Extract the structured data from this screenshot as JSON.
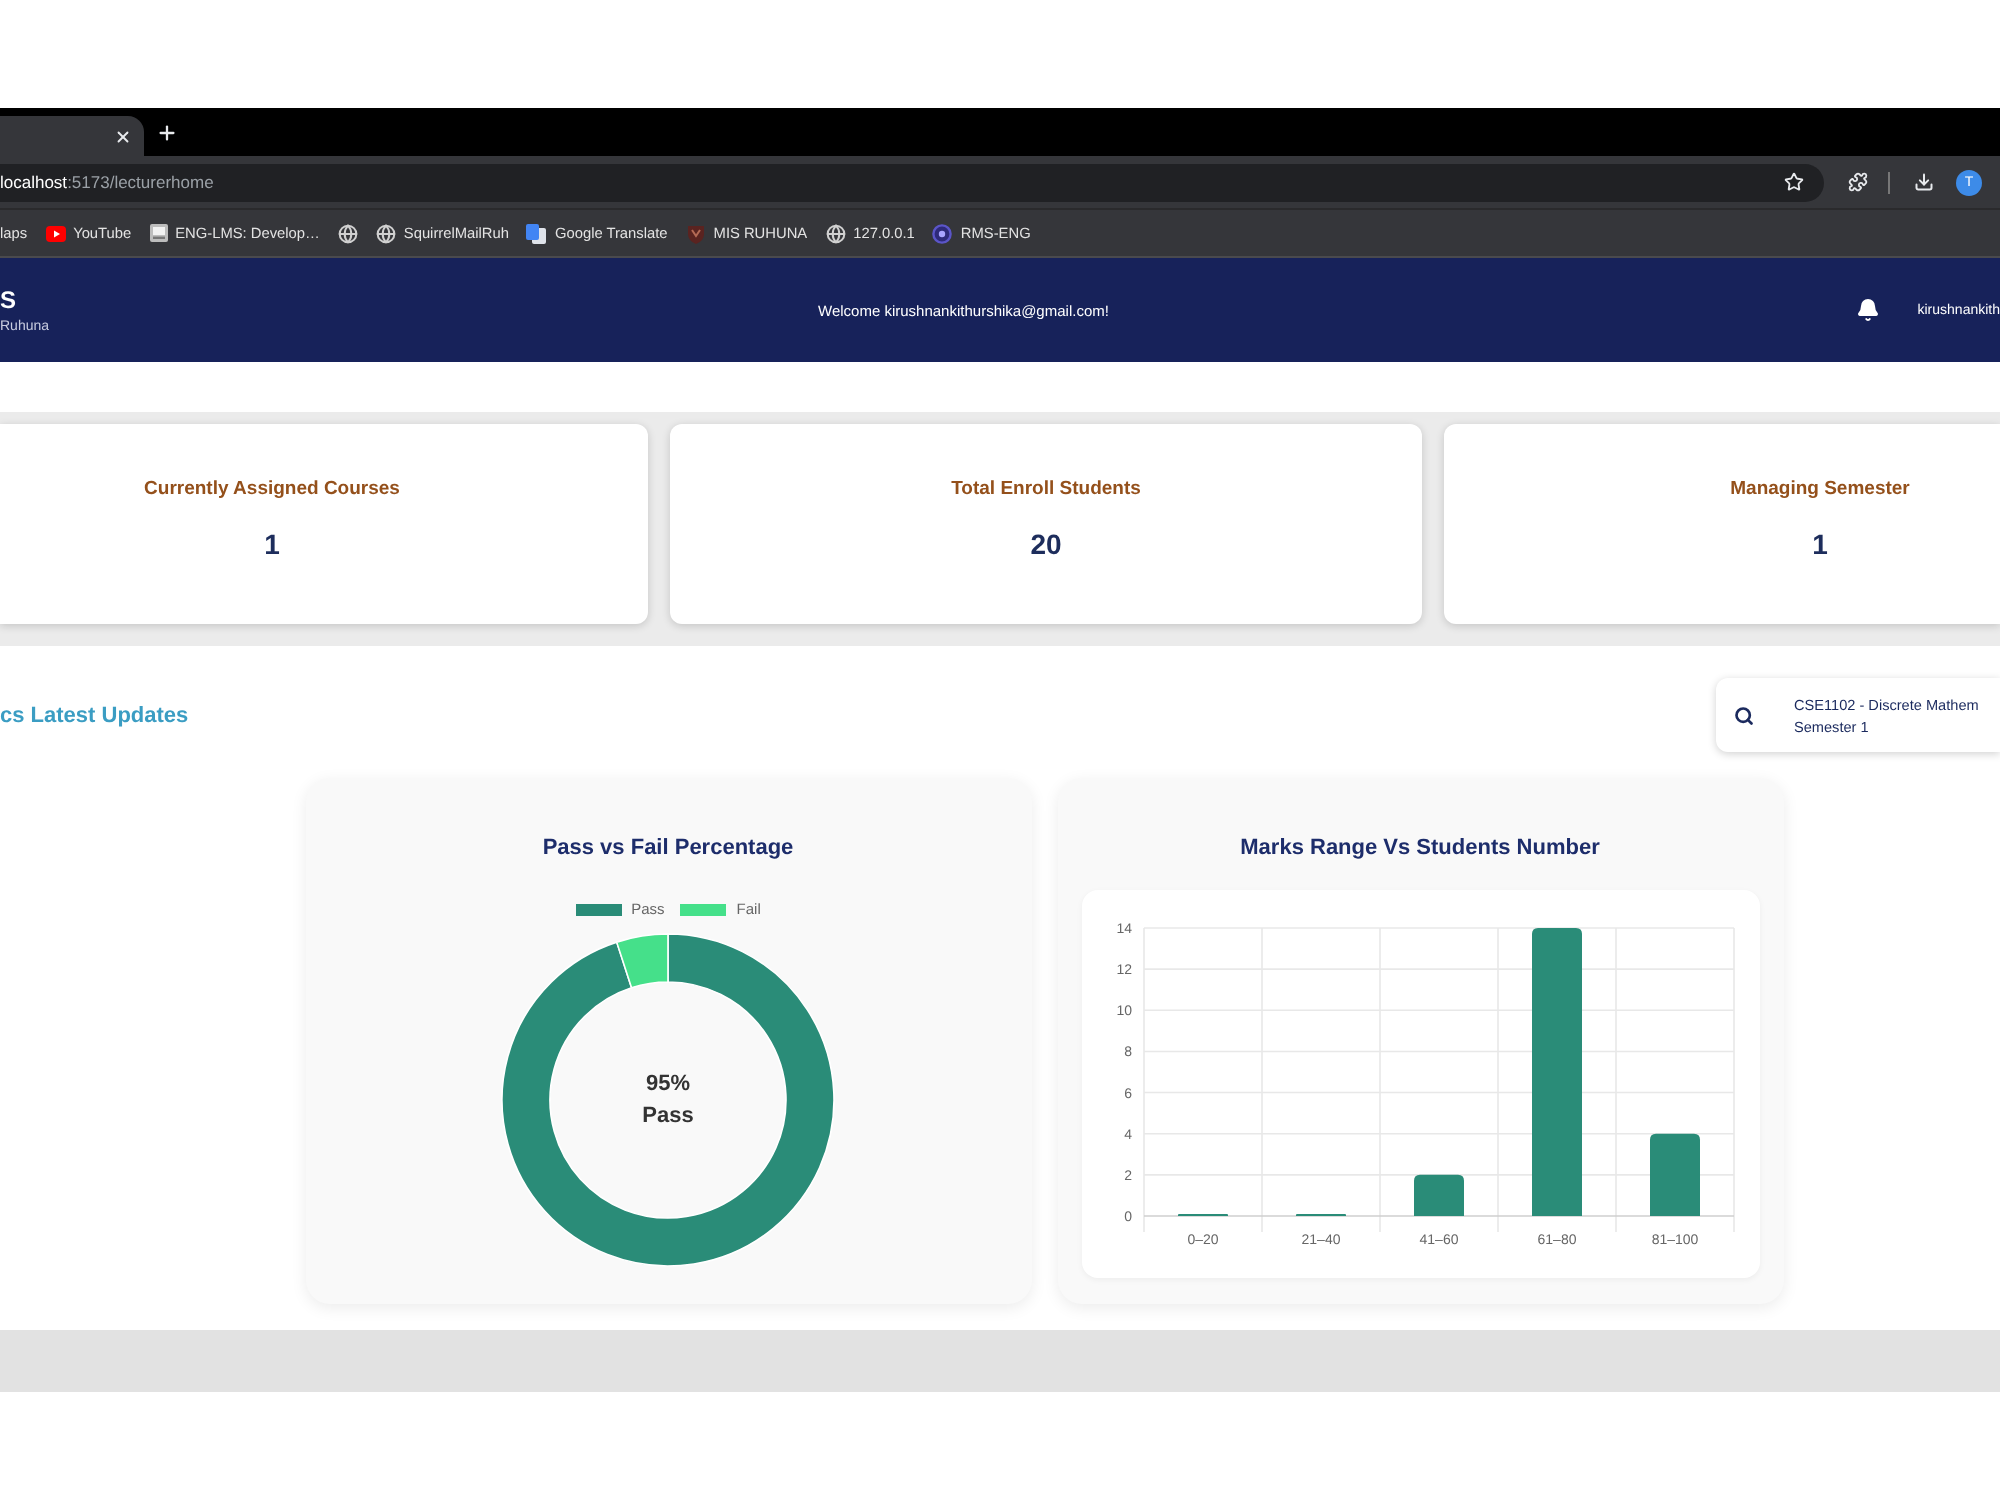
{
  "browser": {
    "tabs": [
      {
        "selected": true
      }
    ],
    "address_bar": {
      "host": "localhost",
      "path": ":5173/lecturerhome"
    },
    "profile_initial": "T",
    "bookmarks": [
      {
        "kind": "text",
        "label": "laps"
      },
      {
        "kind": "youtube",
        "label": "YouTube"
      },
      {
        "kind": "page",
        "label": "ENG-LMS: Develop…"
      },
      {
        "kind": "globe"
      },
      {
        "kind": "globe",
        "label": "SquirrelMailRuh"
      },
      {
        "kind": "translate",
        "label": "Google Translate"
      },
      {
        "kind": "emblem",
        "label": "MIS RUHUNA"
      },
      {
        "kind": "globe",
        "label": "127.0.0.1"
      },
      {
        "kind": "ring",
        "label": "RMS-ENG"
      }
    ]
  },
  "header": {
    "brand": "S",
    "subtitle": "Ruhuna",
    "welcome": "Welcome kirushnankithurshika@gmail.com!",
    "user": "kirushnankith"
  },
  "stats": [
    {
      "title": "Currently Assigned Courses",
      "value": "1"
    },
    {
      "title": "Total Enroll Students",
      "value": "20"
    },
    {
      "title": "Managing Semester",
      "value": "1"
    }
  ],
  "updates": {
    "heading": "cs Latest Updates",
    "course_search": {
      "course": "CSE1102 - Discrete Mathem",
      "semester": "Semester 1"
    },
    "charts": [
      {
        "center_value": "95%",
        "center_caption": "Pass",
        "legend": [
          {
            "color": "#2a8c78"
          },
          {
            "color": "#45e08a"
          }
        ],
        "chart_data": {
          "type": "donut",
          "title": "Pass vs Fail Percentage",
          "categories": [
            "Pass",
            "Fail"
          ],
          "values": [
            95,
            5
          ]
        }
      },
      {
        "chart_data": {
          "type": "bar",
          "title": "Marks Range Vs Students Number",
          "categories": [
            "0–20",
            "21–40",
            "41–60",
            "61–80",
            "81–100"
          ],
          "series": [
            {
              "color": "#2a8c78",
              "values": [
                0,
                0,
                2,
                14,
                4
              ]
            }
          ],
          "ylim": [
            0,
            14
          ],
          "yticks": [
            0,
            2,
            4,
            6,
            8,
            10,
            12,
            14
          ],
          "grid": true
        }
      }
    ]
  }
}
